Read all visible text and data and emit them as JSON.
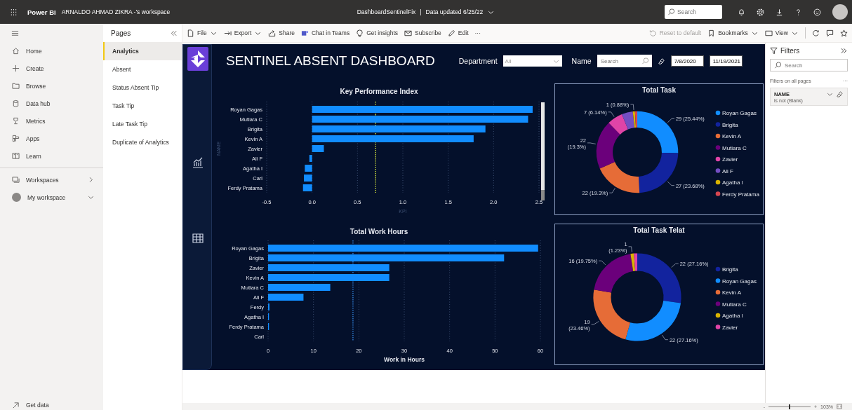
{
  "top_bar": {
    "app_name": "Power BI",
    "workspace": "ARNALDO AHMAD ZIKRA -'s workspace",
    "report_name": "DashboardSentinelFix",
    "separator": "|",
    "data_updated": "Data updated 6/25/22",
    "search": {
      "placeholder": "Search"
    }
  },
  "nav": {
    "items": [
      {
        "label": "Home"
      },
      {
        "label": "Create"
      },
      {
        "label": "Browse"
      },
      {
        "label": "Data hub"
      },
      {
        "label": "Metrics"
      },
      {
        "label": "Apps"
      },
      {
        "label": "Learn"
      }
    ],
    "workspaces": [
      {
        "label": "Workspaces"
      },
      {
        "label": "My workspace"
      }
    ],
    "get_data": "Get data"
  },
  "pages": {
    "title": "Pages",
    "items": [
      {
        "label": "Analytics",
        "selected": true
      },
      {
        "label": "Absent",
        "selected": false
      },
      {
        "label": "Status Absent Tip",
        "selected": false
      },
      {
        "label": "Task Tip",
        "selected": false
      },
      {
        "label": "Late Task Tip",
        "selected": false
      },
      {
        "label": "Duplicate of Analytics",
        "selected": false
      }
    ]
  },
  "toolbar": {
    "items": [
      {
        "label": "File",
        "dropdown": true
      },
      {
        "label": "Export",
        "dropdown": true
      },
      {
        "label": "Share",
        "dropdown": false
      },
      {
        "label": "Chat in Teams",
        "dropdown": false
      },
      {
        "label": "Get insights",
        "dropdown": false
      },
      {
        "label": "Subscribe",
        "dropdown": false
      },
      {
        "label": "Edit",
        "dropdown": false
      }
    ],
    "more": "···",
    "right": [
      {
        "label": "Reset to default",
        "dropdown": false,
        "disabled": true
      },
      {
        "label": "Bookmarks",
        "dropdown": true,
        "disabled": false
      },
      {
        "label": "View",
        "dropdown": true,
        "disabled": false
      }
    ]
  },
  "report": {
    "title": "SENTINEL ABSENT DASHBOARD",
    "department": {
      "label": "Department",
      "value": "All"
    },
    "name": {
      "label": "Name",
      "placeholder": "Search"
    },
    "date_range": {
      "start": "7/8/2020",
      "end": "11/19/2021"
    },
    "charts": [
      {
        "chart_data": {
          "type": "bar",
          "orientation": "horizontal",
          "title": "Key Performance Index",
          "xlabel": "KPI",
          "ylabel": "NAME",
          "categories": [
            "Royan Gagas",
            "Mutiara C",
            "Brigita",
            "Kevin A",
            "Zavier",
            "Ali F",
            "Agatha I",
            "Carl",
            "Ferdy Pratama"
          ],
          "values": [
            2.43,
            2.38,
            1.91,
            1.78,
            0.13,
            -0.03,
            -0.08,
            -0.09,
            -0.1
          ],
          "xlim": [
            -0.5,
            2.5
          ],
          "xticks": [
            -0.5,
            {
              "value": 0,
              "label": "0.0"
            },
            0.5,
            {
              "value": 1,
              "label": "1.0"
            },
            1.5,
            {
              "value": 2,
              "label": "2.0"
            },
            2.5
          ],
          "grid": true,
          "ref_lines": [
            {
              "axis": "x",
              "value": 0.7,
              "color": "#b5c43a"
            }
          ]
        }
      },
      {
        "chart_data": {
          "type": "donut",
          "title": "Total Task",
          "categories": [
            "Royan Gagas",
            "Brigita",
            "Kevin A",
            "Mutiara C",
            "Zavier",
            "Ali F",
            "Agatha I",
            "Ferdy Pratama"
          ],
          "values": [
            29,
            27,
            22,
            22,
            7,
            5,
            1,
            1
          ],
          "colors": [
            "#118dff",
            "#12239e",
            "#e66c37",
            "#6b007b",
            "#e044a7",
            "#744ec2",
            "#d9b300",
            "#d64550"
          ],
          "value_labels": [
            "29 (25.44%)",
            "27 (23.68%)",
            "22 (19.3%)",
            "22\n(19.3%)",
            "7 (6.14%)",
            null,
            "1 (0.88%)",
            null
          ],
          "legend": true
        }
      },
      {
        "chart_data": {
          "type": "bar",
          "orientation": "horizontal",
          "title": "Total Work Hours",
          "xlabel": "Work in Hours",
          "categories": [
            "Royan Gagas",
            "Brigita",
            "Zavier",
            "Kevin A",
            "Mutiara C",
            "Ali F",
            "Ferdy",
            "Agatha I",
            "Ferdy Pratama",
            "Carl"
          ],
          "values": [
            59.5,
            52,
            26.7,
            26.7,
            13.7,
            7.8,
            0.3,
            0.2,
            0.2,
            0
          ],
          "xlim": [
            0,
            60
          ],
          "xticks": [
            0,
            10,
            20,
            30,
            40,
            50,
            60
          ],
          "grid": true,
          "ref_lines": [
            {
              "axis": "x",
              "value": 18.7,
              "color": "#2a6fc0"
            }
          ]
        }
      },
      {
        "chart_data": {
          "type": "donut",
          "title": "Total Task Telat",
          "categories": [
            "Brigita",
            "Royan Gagas",
            "Kevin A",
            "Mutiara C",
            "Agatha I",
            "Zavier"
          ],
          "values": [
            22,
            22,
            19,
            16,
            1,
            1
          ],
          "colors": [
            "#12239e",
            "#118dff",
            "#e66c37",
            "#6b007b",
            "#d9b300",
            "#e044a7"
          ],
          "value_labels": [
            "22 (27.16%)",
            "22 (27.16%)",
            "19\n(23.46%)",
            "16 (19.75%)",
            "1\n(1.23%)",
            null
          ],
          "legend": true
        }
      }
    ]
  },
  "filters": {
    "title": "Filters",
    "search": {
      "placeholder": "Search"
    },
    "section": "Filters on all pages",
    "more": "···",
    "cards": [
      {
        "field": "NAME",
        "condition": "is not (Blank)"
      }
    ]
  },
  "status_bar": {
    "zoom": {
      "minus": "-",
      "plus": "+",
      "level": 0.5,
      "reading": "103%"
    }
  }
}
